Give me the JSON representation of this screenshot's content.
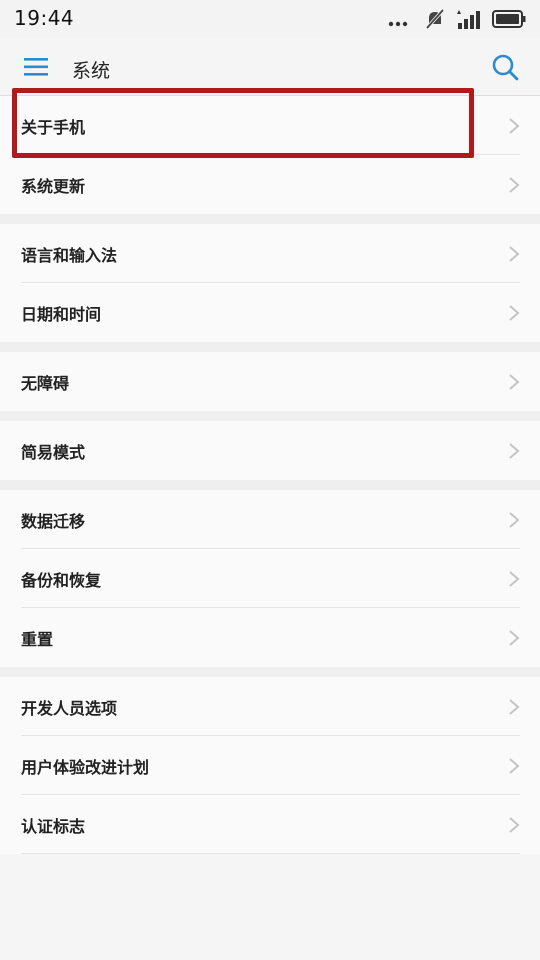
{
  "status": {
    "time": "19:44",
    "icons": [
      "more-dots-icon",
      "silent-icon",
      "signal-icon",
      "battery-icon"
    ]
  },
  "appbar": {
    "title": "系统",
    "icons": [
      "menu-icon",
      "search-icon"
    ]
  },
  "colors": {
    "accent": "#2a8cd0",
    "highlight": "#b11a1a",
    "chevron": "#c4c4c4"
  },
  "groups": [
    {
      "items": [
        {
          "label": "关于手机"
        },
        {
          "label": "系统更新"
        }
      ]
    },
    {
      "items": [
        {
          "label": "语言和输入法"
        },
        {
          "label": "日期和时间"
        }
      ]
    },
    {
      "items": [
        {
          "label": "无障碍"
        }
      ]
    },
    {
      "items": [
        {
          "label": "简易模式"
        }
      ]
    },
    {
      "items": [
        {
          "label": "数据迁移"
        },
        {
          "label": "备份和恢复"
        },
        {
          "label": "重置"
        }
      ]
    },
    {
      "items": [
        {
          "label": "开发人员选项"
        },
        {
          "label": "用户体验改进计划"
        },
        {
          "label": "认证标志"
        }
      ]
    }
  ]
}
